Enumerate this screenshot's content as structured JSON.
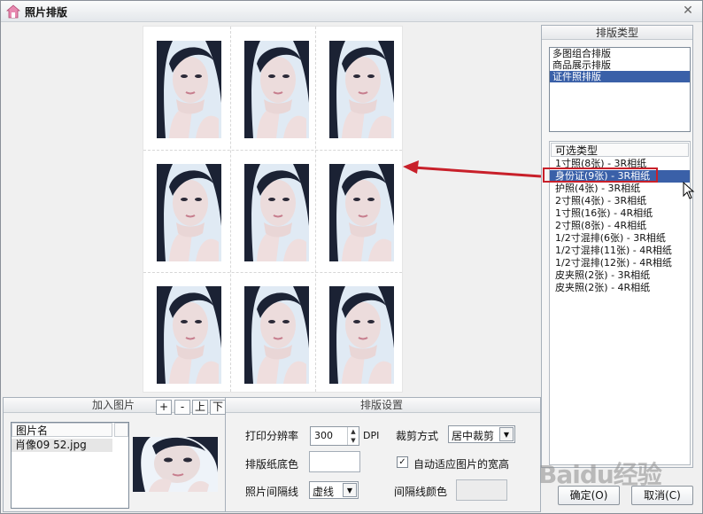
{
  "window": {
    "title": "照片排版",
    "close_symbol": "✕"
  },
  "right_panel": {
    "header": "排版类型",
    "layout_types": [
      {
        "label": "多图组合排版",
        "selected": false
      },
      {
        "label": "商品展示排版",
        "selected": false
      },
      {
        "label": "证件照排版",
        "selected": true
      }
    ],
    "types_header": "可选类型",
    "types": [
      {
        "label": "1寸照(8张) - 3R相纸",
        "selected": false
      },
      {
        "label": "身份证(9张) - 3R相纸",
        "selected": true
      },
      {
        "label": "护照(4张) - 3R相纸",
        "selected": false
      },
      {
        "label": "2寸照(4张) - 3R相纸",
        "selected": false
      },
      {
        "label": "1寸照(16张) - 4R相纸",
        "selected": false
      },
      {
        "label": "2寸照(8张) - 4R相纸",
        "selected": false
      },
      {
        "label": "1/2寸混排(6张) - 3R相纸",
        "selected": false
      },
      {
        "label": "1/2寸混排(11张) - 4R相纸",
        "selected": false
      },
      {
        "label": "1/2寸混排(12张) - 4R相纸",
        "selected": false
      },
      {
        "label": "皮夹照(2张) - 3R相纸",
        "selected": false
      },
      {
        "label": "皮夹照(2张) - 4R相纸",
        "selected": false
      }
    ]
  },
  "add_images": {
    "header": "加入图片",
    "buttons": {
      "add": "+",
      "remove": "-",
      "up": "上",
      "down": "下"
    },
    "column_header": "图片名",
    "files": [
      "肖像09 52.jpg"
    ]
  },
  "settings": {
    "header": "排版设置",
    "dpi_label": "打印分辨率",
    "dpi_value": "300",
    "dpi_unit": "DPI",
    "crop_label": "裁剪方式",
    "crop_value": "居中裁剪",
    "paper_color_label": "排版纸底色",
    "autofit_label": "自动适应图片的宽高",
    "autofit_checked": "✓",
    "gap_line_label": "照片间隔线",
    "gap_line_value": "虚线",
    "gap_color_label": "间隔线颜色"
  },
  "footer": {
    "ok": "确定(O)",
    "cancel": "取消(C)",
    "watermark": "Baidu经验"
  },
  "colors": {
    "accent": "#3a60a8",
    "highlight": "#c8202a",
    "paper": "#ffffff"
  }
}
